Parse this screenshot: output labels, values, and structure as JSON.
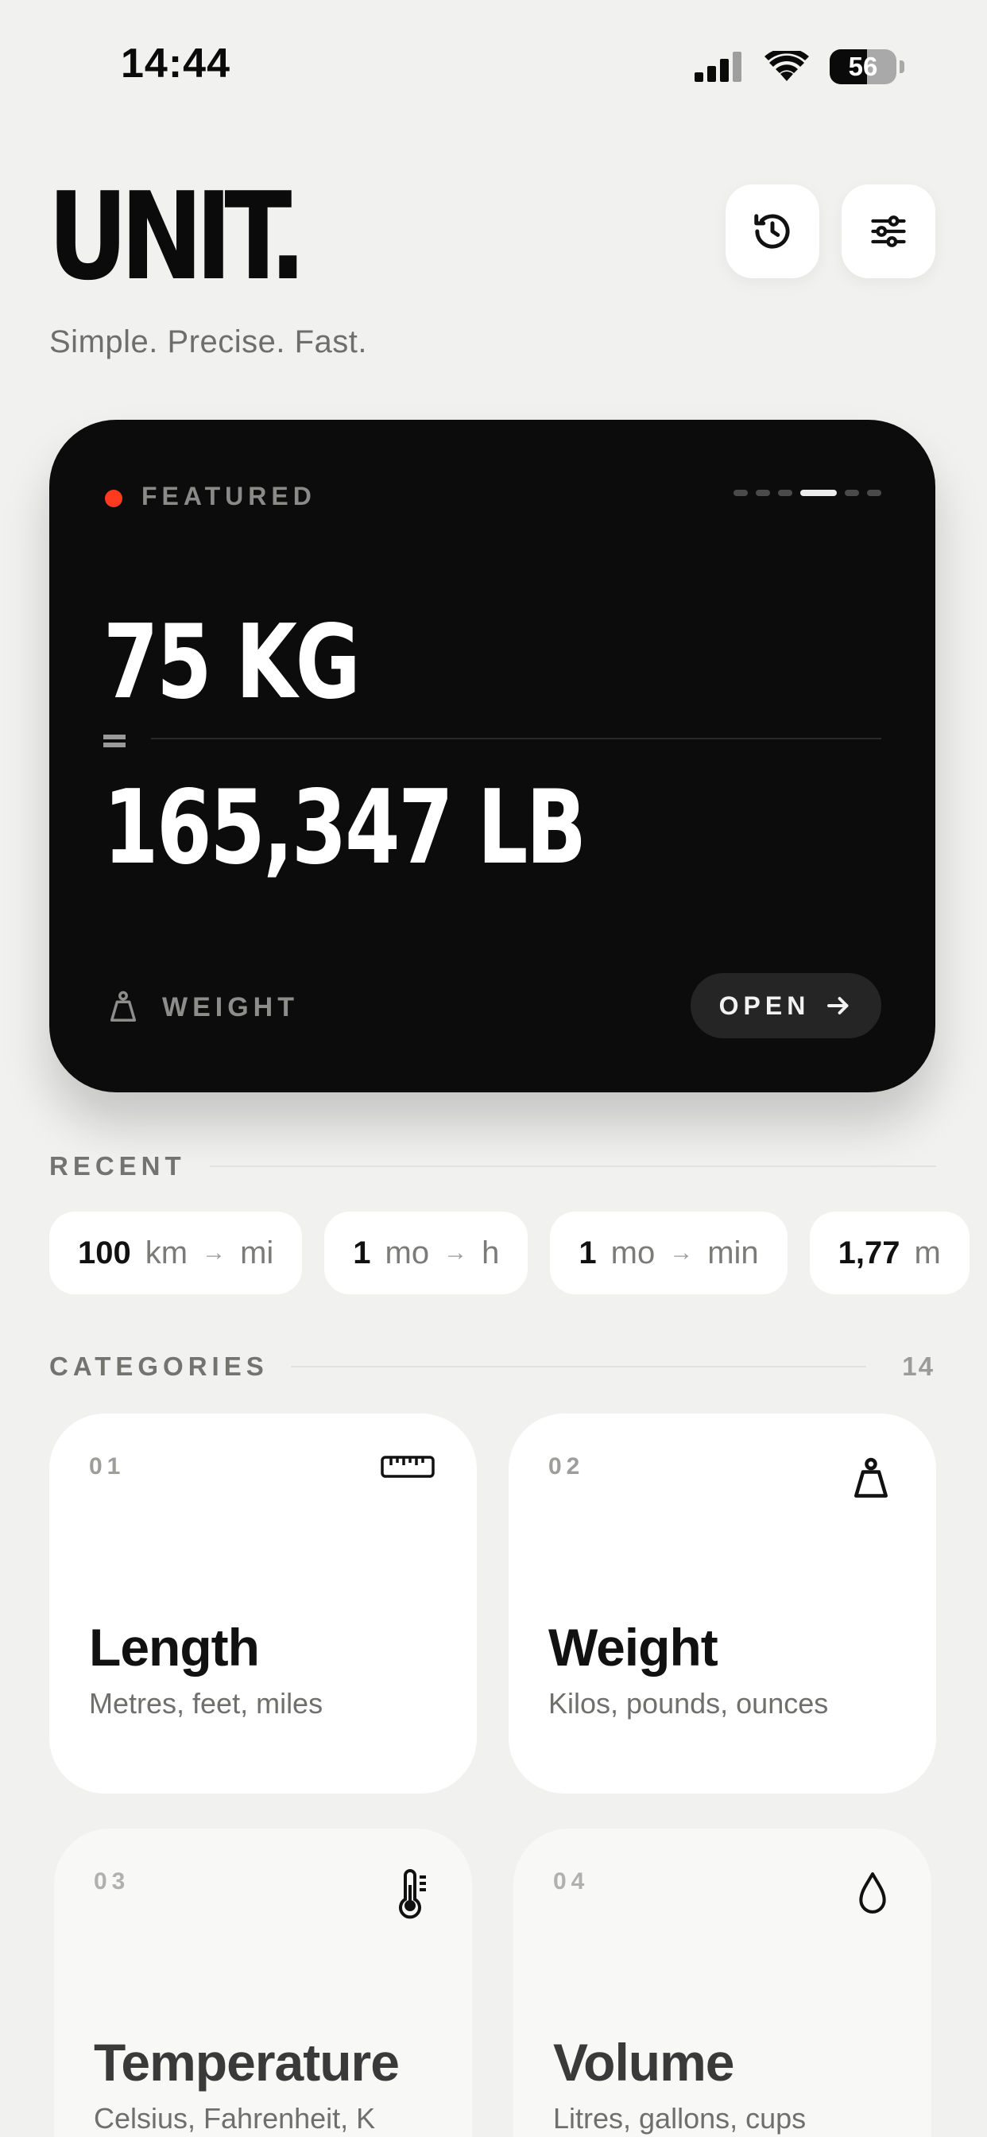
{
  "status": {
    "time": "14:44",
    "battery": "56",
    "battery_level": 0.56,
    "icons": [
      "cellular-signal-icon",
      "wifi-icon",
      "battery-icon"
    ]
  },
  "header": {
    "brand": "UNIT.",
    "tagline": "Simple. Precise. Fast.",
    "buttons": [
      "history-icon",
      "sliders-icon"
    ]
  },
  "featured": {
    "label": "FEATURED",
    "dot_color": "#ff3b1f",
    "pages": 6,
    "active_page": 4,
    "from": "75 KG",
    "to": "165,347 LB",
    "category": "WEIGHT",
    "category_icon": "weight-icon",
    "open_label": "OPEN",
    "open_icon": "arrow-right-icon"
  },
  "recent": {
    "title": "RECENT",
    "chips": [
      {
        "value": "100",
        "from": "km",
        "to": "mi"
      },
      {
        "value": "1",
        "from": "mo",
        "to": "h"
      },
      {
        "value": "1",
        "from": "mo",
        "to": "min"
      },
      {
        "value": "1,77",
        "from": "m",
        "to": ""
      }
    ],
    "arrow": "→"
  },
  "categories": {
    "title": "CATEGORIES",
    "count": "14",
    "items": [
      {
        "num": "01",
        "name": "Length",
        "desc": "Metres, feet, miles",
        "icon": "ruler-icon"
      },
      {
        "num": "02",
        "name": "Weight",
        "desc": "Kilos, pounds, ounces",
        "icon": "weight-icon"
      },
      {
        "num": "03",
        "name": "Temperature",
        "desc": "Celsius, Fahrenheit, K",
        "icon": "thermometer-icon"
      },
      {
        "num": "04",
        "name": "Volume",
        "desc": "Litres, gallons, cups",
        "icon": "droplet-icon"
      }
    ]
  }
}
